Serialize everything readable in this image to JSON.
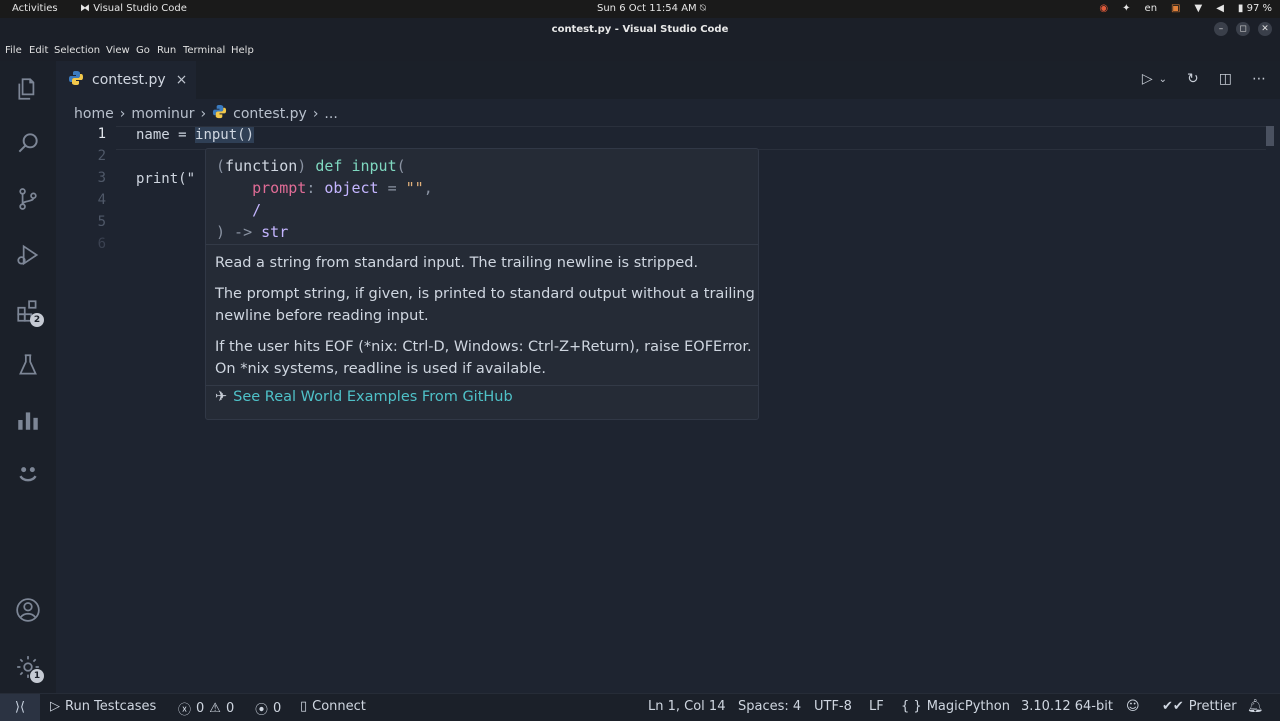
{
  "topbar": {
    "activities": "Activities",
    "app": "Visual Studio Code",
    "datetime": "Sun 6 Oct  11:54 AM",
    "lang": "en",
    "battery": "97 %"
  },
  "window": {
    "title": "contest.py - Visual Studio Code"
  },
  "menu": {
    "items": [
      "File",
      "Edit",
      "Selection",
      "View",
      "Go",
      "Run",
      "Terminal",
      "Help"
    ]
  },
  "activity_bar": {
    "extensions_badge": "2",
    "settings_badge": "1"
  },
  "tab": {
    "filename": "contest.py",
    "close": "×"
  },
  "breadcrumbs": {
    "home": "home",
    "user": "mominur",
    "file": "contest.py",
    "more": "..."
  },
  "editor": {
    "line_numbers": [
      "1",
      "2",
      "3",
      "4",
      "5",
      "6"
    ],
    "line1_var": "name",
    "line1_eq": " = ",
    "line1_call": "input()",
    "line3": "print(\""
  },
  "hover": {
    "sig_open": "(",
    "sig_function": "function",
    "sig_close": ")",
    "sig_def": "def",
    "sig_name": "input",
    "sig_paren": "(",
    "param_name": "prompt",
    "param_colon": ": ",
    "param_type": "object",
    "param_eq": " = ",
    "param_default": "\"\"",
    "param_comma": ",",
    "slash": "/",
    "ret_paren": ")",
    "ret_arrow": " -> ",
    "ret_type": "str",
    "doc1": "Read a string from standard input. The trailing newline is stripped.",
    "doc2": "The prompt string, if given, is printed to standard output without a trailing newline before reading input.",
    "doc3": "If the user hits EOF (*nix: Ctrl-D, Windows: Ctrl-Z+Return), raise EOFError. On *nix systems, readline is used if available.",
    "link": "See Real World Examples From GitHub"
  },
  "status": {
    "run_testcases": "Run Testcases",
    "errors": "0",
    "warnings": "0",
    "ports": "0",
    "connect": "Connect",
    "position": "Ln 1, Col 14",
    "spaces": "Spaces: 4",
    "encoding": "UTF-8",
    "eol": "LF",
    "language": "MagicPython",
    "interpreter": "3.10.12 64-bit",
    "prettier": "Prettier"
  },
  "colors": {
    "accent": "#4fc1c8",
    "background": "#1e2430"
  }
}
